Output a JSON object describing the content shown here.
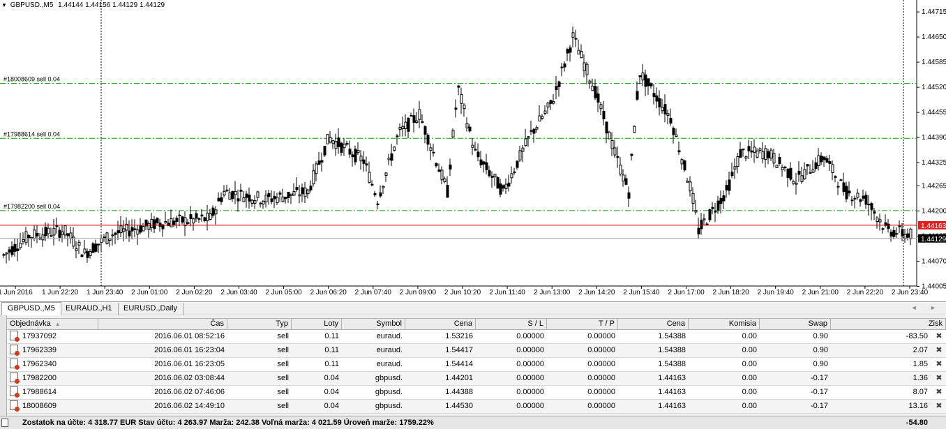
{
  "chart": {
    "symbol": "GBPUSD.,M5",
    "ohlc": "1.44144 1.44156 1.44129 1.44129",
    "price_axis": [
      "1.44715",
      "1.44650",
      "1.44585",
      "1.44520",
      "1.44455",
      "1.44390",
      "1.44325",
      "1.44265",
      "1.44200",
      "1.44135",
      "1.44070",
      "1.44005"
    ],
    "time_axis": [
      "1 Jun 2016",
      "1 Jun 22:20",
      "1 Jun 23:40",
      "2 Jun 01:00",
      "2 Jun 02:20",
      "2 Jun 03:40",
      "2 Jun 05:00",
      "2 Jun 06:20",
      "2 Jun 07:40",
      "2 Jun 09:00",
      "2 Jun 10:20",
      "2 Jun 11:40",
      "2 Jun 13:00",
      "2 Jun 14:20",
      "2 Jun 15:40",
      "2 Jun 17:00",
      "2 Jun 18:20",
      "2 Jun 19:40",
      "2 Jun 21:00",
      "2 Jun 22:20",
      "2 Jun 23:40"
    ],
    "orders": [
      {
        "label": "#18008609 sell 0.04",
        "price": 1.4453
      },
      {
        "label": "#17988614 sell 0.04",
        "price": 1.44388
      },
      {
        "label": "#17982200 sell 0.04",
        "price": 1.44201
      }
    ],
    "ask_tag": "1.44163",
    "bid_tag": "1.44129",
    "colors": {
      "order_line": "#00a000",
      "ask_line": "#c00000",
      "bid_line": "#a0a0a0",
      "candle": "#000000",
      "ask_tag_bg": "#e02020",
      "bid_tag_bg": "#000000"
    }
  },
  "tabs": [
    {
      "label": "GBPUSD.,M5",
      "active": true
    },
    {
      "label": "EURAUD.,H1",
      "active": false
    },
    {
      "label": "EURUSD.,Daily",
      "active": false
    }
  ],
  "tab_arrows": "◄ ►",
  "table": {
    "headers": [
      "Objednávka",
      "Čas",
      "Typ",
      "Loty",
      "Symbol",
      "Cena",
      "S / L",
      "T / P",
      "Cena",
      "Komisia",
      "Swap",
      "Zisk"
    ],
    "rows": [
      [
        "17937092",
        "2016.06.01 08:52:16",
        "sell",
        "0.11",
        "euraud.",
        "1.53216",
        "0.00000",
        "0.00000",
        "1.54388",
        "0.00",
        "0.90",
        "-83.50"
      ],
      [
        "17962339",
        "2016.06.01 16:23:04",
        "sell",
        "0.11",
        "euraud.",
        "1.54417",
        "0.00000",
        "0.00000",
        "1.54388",
        "0.00",
        "0.90",
        "2.07"
      ],
      [
        "17962340",
        "2016.06.01 16:23:05",
        "sell",
        "0.11",
        "euraud.",
        "1.54414",
        "0.00000",
        "0.00000",
        "1.54388",
        "0.00",
        "0.90",
        "1.85"
      ],
      [
        "17982200",
        "2016.06.02 03:08:44",
        "sell",
        "0.04",
        "gbpusd.",
        "1.44201",
        "0.00000",
        "0.00000",
        "1.44163",
        "0.00",
        "-0.17",
        "1.36"
      ],
      [
        "17988614",
        "2016.06.02 07:46:06",
        "sell",
        "0.04",
        "gbpusd.",
        "1.44388",
        "0.00000",
        "0.00000",
        "1.44163",
        "0.00",
        "-0.17",
        "8.07"
      ],
      [
        "18008609",
        "2016.06.02 14:49:10",
        "sell",
        "0.04",
        "gbpusd.",
        "1.44530",
        "0.00000",
        "0.00000",
        "1.44163",
        "0.00",
        "-0.17",
        "13.16"
      ]
    ]
  },
  "summary": {
    "text": "Zostatok na účte: 4 318.77 EUR  Stav účtu: 4 263.97  Marža: 242.38  Voľná marža: 4 021.59  Úroveň marže: 1759.22%",
    "total": "-54.80"
  }
}
